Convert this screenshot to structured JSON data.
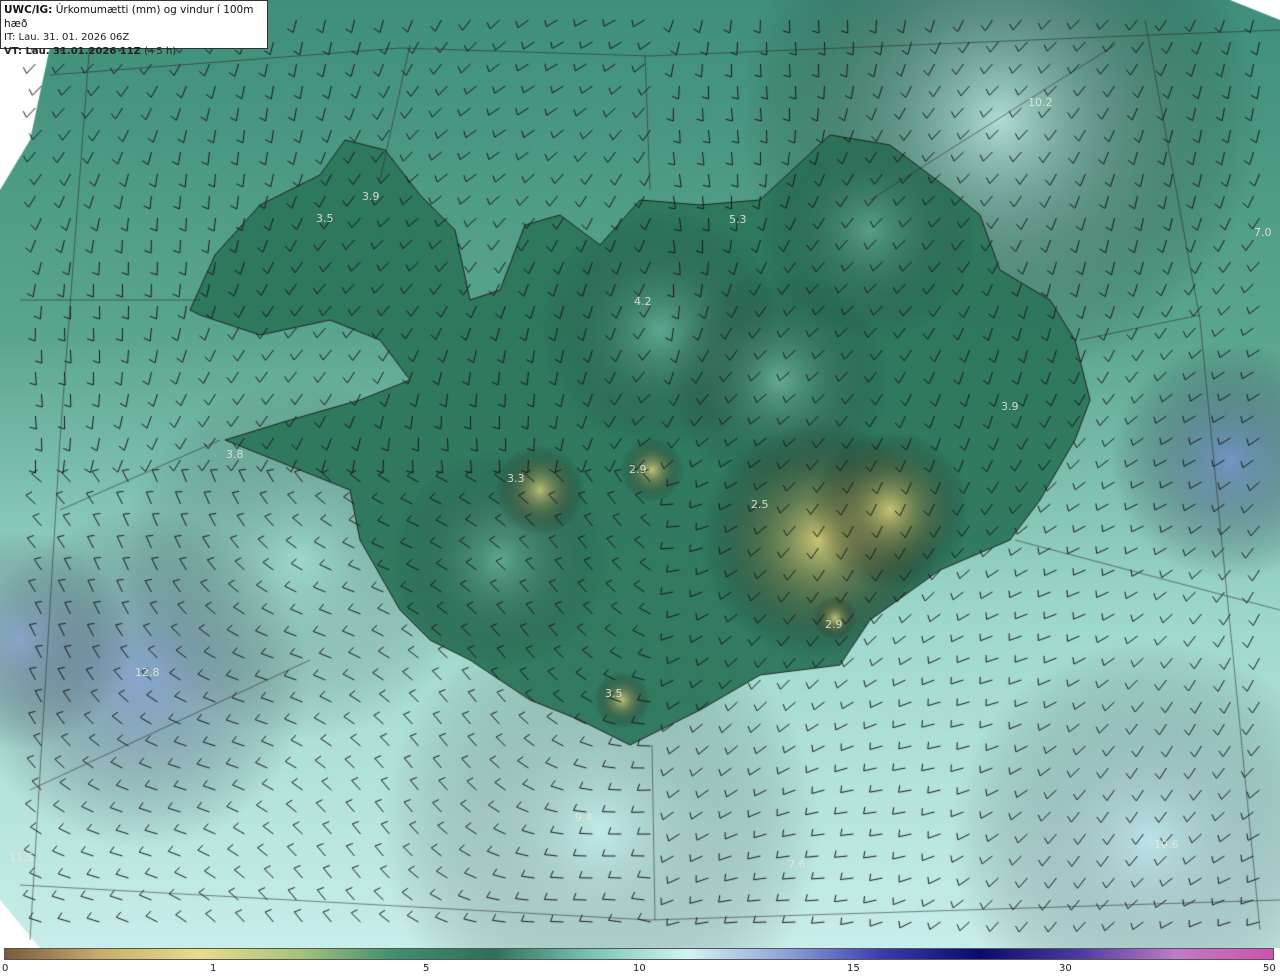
{
  "header": {
    "model_tag": "UWC/IG:",
    "product": "Úrkomumætti (mm) og vindur í 100m hæð",
    "issue_line": "IT: Lau. 31. 01. 2026 06Z",
    "valid_bold": "VT: Lau. 31.01.2026 11Z",
    "valid_offset": "(+5 h)"
  },
  "map_labels": [
    "3.9",
    "3.5",
    "4.2",
    "3.9",
    "3.8",
    "3.3",
    "2.9",
    "2.5",
    "2.9",
    "3.5",
    "10.2",
    "7.0",
    "12.8",
    "9.4",
    "7.6",
    "11.5",
    "10.6",
    "5.3"
  ],
  "colorbar": {
    "ticks": [
      "0",
      "1",
      "5",
      "10",
      "15",
      "30",
      "50"
    ],
    "colors": [
      "#7a5a3c",
      "#c9b06a",
      "#e8dc8a",
      "#a9c47a",
      "#3f8f6e",
      "#2f6f5a",
      "#78c4b4",
      "#d2f4f2",
      "#8ea2dc",
      "#3a3ab0",
      "#0a0a6e",
      "#4a3aa0",
      "#c07ac8",
      "#d050b0"
    ]
  }
}
